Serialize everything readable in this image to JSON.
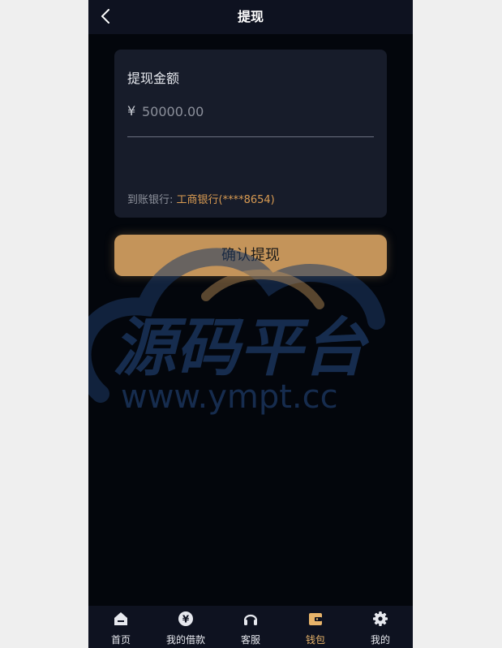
{
  "header": {
    "title": "提现"
  },
  "withdraw": {
    "amount_label": "提现金额",
    "currency_symbol": "¥",
    "amount_placeholder": "50000.00",
    "bank_label": "到账银行:",
    "bank_value": "工商银行(****8654)",
    "confirm_label": "确认提现"
  },
  "watermark": {
    "brand_text": "源码平台",
    "url_text": "www.ympt.cc"
  },
  "tabbar": {
    "items": [
      {
        "label": "首页",
        "icon": "home-icon",
        "active": false
      },
      {
        "label": "我的借款",
        "icon": "yen-coin-icon",
        "active": false
      },
      {
        "label": "客服",
        "icon": "headset-icon",
        "active": false
      },
      {
        "label": "钱包",
        "icon": "wallet-icon",
        "active": true
      },
      {
        "label": "我的",
        "icon": "gear-icon",
        "active": false
      }
    ]
  },
  "colors": {
    "background": "#03060c",
    "card": "#171c2a",
    "accent": "#c4945a",
    "bank_value": "#d99b52",
    "active_tab": "#e8b46a"
  }
}
